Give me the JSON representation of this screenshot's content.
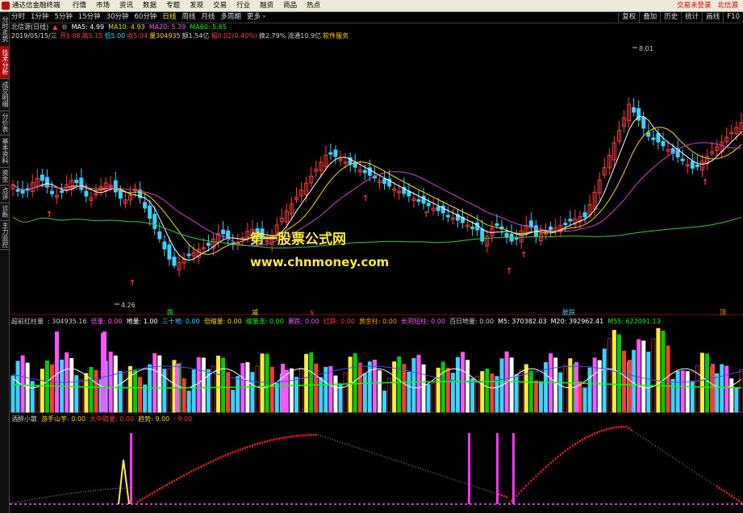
{
  "app": {
    "title": "通达信金融终端",
    "menu": [
      "行情",
      "市场",
      "资讯",
      "数据",
      "专题",
      "发现",
      "交易",
      "行业",
      "融资",
      "商品",
      "热点"
    ],
    "right_links": [
      "交易未登录",
      "北信源"
    ]
  },
  "toolbar": {
    "periods": [
      "分时",
      "1分钟",
      "5分钟",
      "15分钟",
      "30分钟",
      "60分钟",
      "日线",
      "周线",
      "月线",
      "多周期",
      "更多 ›"
    ],
    "active": "日线",
    "right_buttons": [
      "复权",
      "叠加",
      "历史",
      "统计",
      "画线",
      "F10"
    ]
  },
  "sidebar": {
    "tabs": [
      "分时走势",
      "技术分析",
      "成交明细",
      "分价表",
      "基本资料",
      "资金",
      "点评",
      "诊断",
      "主力监控"
    ],
    "active": "技术分析"
  },
  "stock": {
    "name": "北信源(日线)",
    "date": "2019/05/15/三",
    "quote": [
      {
        "k": "开",
        "v": "5.08",
        "c": "#ff3b3b"
      },
      {
        "k": "高",
        "v": "5.15",
        "c": "#ff3b3b"
      },
      {
        "k": "低",
        "v": "5.00",
        "c": "#3ed1ff"
      },
      {
        "k": "收",
        "v": "5.04",
        "c": "#ff3b3b"
      },
      {
        "k": "量",
        "v": "304935",
        "c": "#ffd700"
      },
      {
        "k": "额",
        "v": "1.54亿",
        "c": "#ccc"
      },
      {
        "k": "幅",
        "v": "0.02(0.40%)",
        "c": "#ff3b3b"
      },
      {
        "k": "换",
        "v": "2.79%",
        "c": "#ccc"
      },
      {
        "k": "流通",
        "v": "10.9亿",
        "c": "#ccc"
      },
      {
        "k": "",
        "v": "软件服务",
        "c": "#ffd700"
      }
    ]
  },
  "ma": [
    {
      "label": "MA5: 4.99",
      "color": "#ffffff"
    },
    {
      "label": "MA10: 4.93",
      "color": "#ffd700"
    },
    {
      "label": "MA20: 5.39",
      "color": "#ff55ff"
    },
    {
      "label": "MA60: 5.65",
      "color": "#00ff00"
    }
  ],
  "price_labels": {
    "high": "8.01",
    "low": "4.26"
  },
  "watermark": {
    "line1": "第一股票公式网",
    "line2": "www.chnmoney.com"
  },
  "vol_header": [
    {
      "t": "超前红柱量",
      "c": "#ccc"
    },
    {
      "t": ": 304935.16",
      "c": "#ccc"
    },
    {
      "t": "倍量: 0.00",
      "c": "#ff55ff"
    },
    {
      "t": "地量: 1.00",
      "c": "#fff"
    },
    {
      "t": "三十地: 0.00",
      "c": "#3ed1ff"
    },
    {
      "t": "倍缩量: 0.00",
      "c": "#ffd700"
    },
    {
      "t": "缩量涨: 0.00",
      "c": "#00ff00"
    },
    {
      "t": "果跌: 0.00",
      "c": "#ff55ff"
    },
    {
      "t": "红跌: 0.00",
      "c": "#ff3b3b"
    },
    {
      "t": "黄金柱: 0.00",
      "c": "#ff9900"
    },
    {
      "t": "长阴短柱: 0.00",
      "c": "#ff55ff"
    },
    {
      "t": "百日地量: 0.00",
      "c": "#ccc"
    },
    {
      "t": "M5: 370382.03",
      "c": "#fff"
    },
    {
      "t": "M20: 392962.41",
      "c": "#fff"
    },
    {
      "t": "M55: 622091.13",
      "c": "#00ff00"
    }
  ],
  "vol_tags": [
    {
      "t": "跳",
      "c": "#00ff00"
    },
    {
      "t": "减",
      "c": "#ffd700"
    },
    {
      "t": "$",
      "c": "#ff3b3b"
    },
    {
      "t": "胀跌",
      "c": "#3ed1ff"
    },
    {
      "t": "顶",
      "c": "#ff9900"
    }
  ],
  "ind_header": [
    {
      "t": "酒醉小散",
      "c": "#ccc"
    },
    {
      "t": "游手山芋: 0.00",
      "c": "#ffd700"
    },
    {
      "t": "大中取量: 0.00",
      "c": "#ff3b3b"
    },
    {
      "t": "趋势: 9.00",
      "c": "#ffd700"
    },
    {
      "t": ": 9.00",
      "c": "#ff3b3b"
    }
  ],
  "colors": {
    "up": "#ff3b3b",
    "down": "#3ed1ff",
    "ma5": "#ffffff",
    "ma10": "#ffd700",
    "ma20": "#cc44cc",
    "ma60": "#33cc33"
  }
}
